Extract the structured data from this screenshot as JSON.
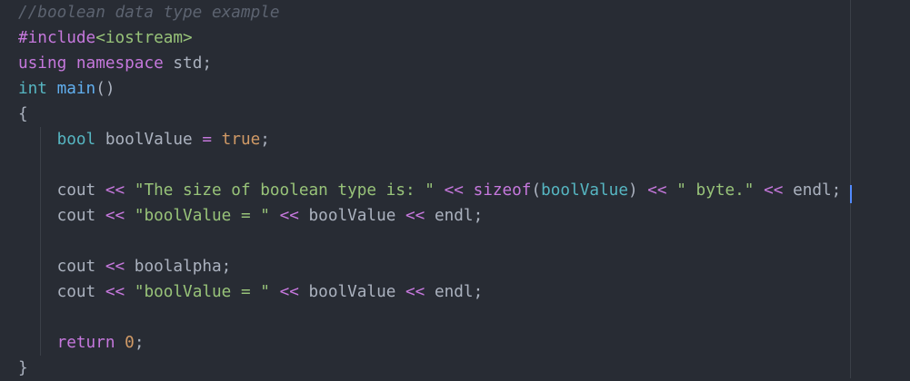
{
  "editor": {
    "theme_colors": {
      "background": "#282c34",
      "comment": "#5c6370",
      "keyword": "#c678dd",
      "type": "#56b6c2",
      "function": "#61afef",
      "string": "#98c379",
      "number": "#d19a66",
      "plain": "#abb2bf"
    },
    "lines": [
      {
        "tokens": [
          {
            "t": "comment",
            "v": "//boolean data type example"
          }
        ]
      },
      {
        "tokens": [
          {
            "t": "preproc",
            "v": "#include"
          },
          {
            "t": "header",
            "v": "<iostream>"
          }
        ]
      },
      {
        "tokens": [
          {
            "t": "keyword",
            "v": "using"
          },
          {
            "t": "plain",
            "v": " "
          },
          {
            "t": "keyword",
            "v": "namespace"
          },
          {
            "t": "plain",
            "v": " std;"
          }
        ]
      },
      {
        "tokens": [
          {
            "t": "type",
            "v": "int"
          },
          {
            "t": "plain",
            "v": " "
          },
          {
            "t": "func",
            "v": "main"
          },
          {
            "t": "plain",
            "v": "()"
          }
        ]
      },
      {
        "tokens": [
          {
            "t": "plain",
            "v": "{"
          }
        ]
      },
      {
        "tokens": [
          {
            "t": "plain",
            "v": "    "
          },
          {
            "t": "type",
            "v": "bool"
          },
          {
            "t": "plain",
            "v": " boolValue "
          },
          {
            "t": "op",
            "v": "="
          },
          {
            "t": "plain",
            "v": " "
          },
          {
            "t": "literal",
            "v": "true"
          },
          {
            "t": "plain",
            "v": ";"
          }
        ]
      },
      {
        "tokens": [
          {
            "t": "plain",
            "v": ""
          }
        ]
      },
      {
        "tokens": [
          {
            "t": "plain",
            "v": "    cout "
          },
          {
            "t": "op",
            "v": "<<"
          },
          {
            "t": "plain",
            "v": " "
          },
          {
            "t": "string",
            "v": "\"The size of boolean type is: \""
          },
          {
            "t": "plain",
            "v": " "
          },
          {
            "t": "op",
            "v": "<<"
          },
          {
            "t": "plain",
            "v": " "
          },
          {
            "t": "keyword",
            "v": "sizeof"
          },
          {
            "t": "plain",
            "v": "("
          },
          {
            "t": "param",
            "v": "boolValue"
          },
          {
            "t": "plain",
            "v": ") "
          },
          {
            "t": "op",
            "v": "<<"
          },
          {
            "t": "plain",
            "v": " "
          },
          {
            "t": "string",
            "v": "\" byte.\""
          },
          {
            "t": "plain",
            "v": " "
          },
          {
            "t": "op",
            "v": "<<"
          },
          {
            "t": "plain",
            "v": " endl;"
          }
        ]
      },
      {
        "tokens": [
          {
            "t": "plain",
            "v": "    cout "
          },
          {
            "t": "op",
            "v": "<<"
          },
          {
            "t": "plain",
            "v": " "
          },
          {
            "t": "string",
            "v": "\"boolValue = \""
          },
          {
            "t": "plain",
            "v": " "
          },
          {
            "t": "op",
            "v": "<<"
          },
          {
            "t": "plain",
            "v": " boolValue "
          },
          {
            "t": "op",
            "v": "<<"
          },
          {
            "t": "plain",
            "v": " endl;"
          }
        ]
      },
      {
        "tokens": [
          {
            "t": "plain",
            "v": ""
          }
        ]
      },
      {
        "tokens": [
          {
            "t": "plain",
            "v": "    cout "
          },
          {
            "t": "op",
            "v": "<<"
          },
          {
            "t": "plain",
            "v": " boolalpha;"
          }
        ]
      },
      {
        "tokens": [
          {
            "t": "plain",
            "v": "    cout "
          },
          {
            "t": "op",
            "v": "<<"
          },
          {
            "t": "plain",
            "v": " "
          },
          {
            "t": "string",
            "v": "\"boolValue = \""
          },
          {
            "t": "plain",
            "v": " "
          },
          {
            "t": "op",
            "v": "<<"
          },
          {
            "t": "plain",
            "v": " boolValue "
          },
          {
            "t": "op",
            "v": "<<"
          },
          {
            "t": "plain",
            "v": " endl;"
          }
        ]
      },
      {
        "tokens": [
          {
            "t": "plain",
            "v": ""
          }
        ]
      },
      {
        "tokens": [
          {
            "t": "plain",
            "v": "    "
          },
          {
            "t": "keyword",
            "v": "return"
          },
          {
            "t": "plain",
            "v": " "
          },
          {
            "t": "literal",
            "v": "0"
          },
          {
            "t": "plain",
            "v": ";"
          }
        ]
      },
      {
        "tokens": [
          {
            "t": "plain",
            "v": "}"
          }
        ]
      }
    ]
  }
}
